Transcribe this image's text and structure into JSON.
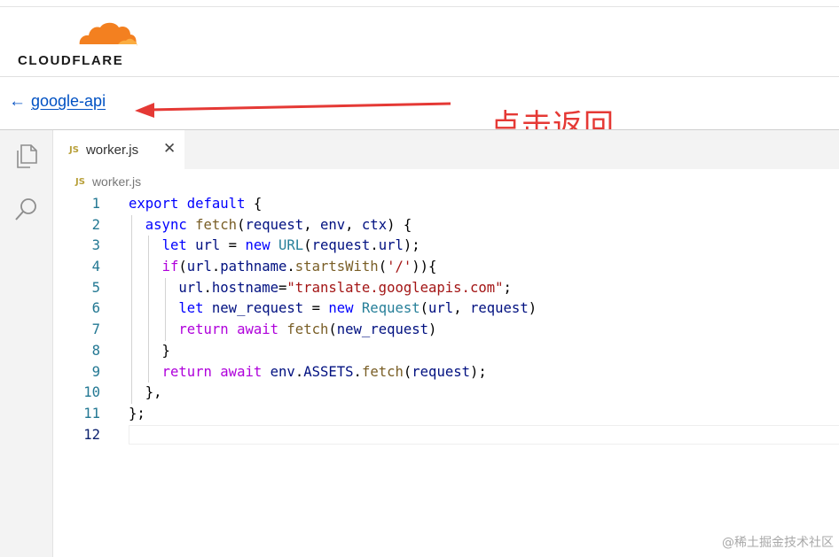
{
  "brand": {
    "name": "CLOUDFLARE",
    "cloud_color": "#f38020"
  },
  "nav": {
    "back_label": "google-api"
  },
  "annotation": {
    "text": "点击返回",
    "color": "#e53935"
  },
  "activity_bar": {
    "items": [
      "files-icon",
      "search-icon"
    ]
  },
  "editor": {
    "tab": {
      "lang_badge": "JS",
      "filename": "worker.js"
    },
    "breadcrumb": {
      "lang_badge": "JS",
      "filename": "worker.js"
    },
    "lines": [
      {
        "n": "1",
        "code": "export default {"
      },
      {
        "n": "2",
        "code": "  async fetch(request, env, ctx) {"
      },
      {
        "n": "3",
        "code": "    let url = new URL(request.url);"
      },
      {
        "n": "4",
        "code": "    if(url.pathname.startsWith('/')){"
      },
      {
        "n": "5",
        "code": "      url.hostname=\"translate.googleapis.com\";"
      },
      {
        "n": "6",
        "code": "      let new_request = new Request(url, request)"
      },
      {
        "n": "7",
        "code": "      return await fetch(new_request)"
      },
      {
        "n": "8",
        "code": "    }"
      },
      {
        "n": "9",
        "code": "    return await env.ASSETS.fetch(request);"
      },
      {
        "n": "10",
        "code": "  },"
      },
      {
        "n": "11",
        "code": "};"
      },
      {
        "n": "12",
        "code": ""
      }
    ],
    "active_line": "12"
  },
  "watermark": "@稀土掘金技术社区"
}
